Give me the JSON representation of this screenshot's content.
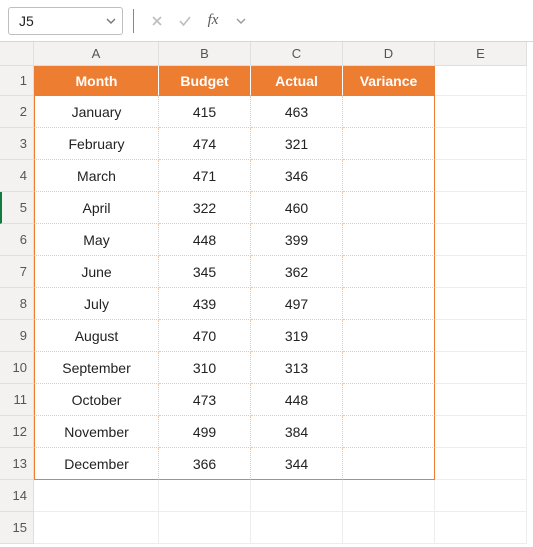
{
  "formula_bar": {
    "name_box_value": "J5",
    "formula_value": ""
  },
  "columns": [
    "A",
    "B",
    "C",
    "D",
    "E"
  ],
  "row_numbers": [
    "1",
    "2",
    "3",
    "4",
    "5",
    "6",
    "7",
    "8",
    "9",
    "10",
    "11",
    "12",
    "13",
    "14",
    "15"
  ],
  "active_row": "5",
  "table": {
    "headers": [
      "Month",
      "Budget",
      "Actual",
      "Variance"
    ],
    "rows": [
      {
        "month": "January",
        "budget": "415",
        "actual": "463",
        "variance": ""
      },
      {
        "month": "February",
        "budget": "474",
        "actual": "321",
        "variance": ""
      },
      {
        "month": "March",
        "budget": "471",
        "actual": "346",
        "variance": ""
      },
      {
        "month": "April",
        "budget": "322",
        "actual": "460",
        "variance": ""
      },
      {
        "month": "May",
        "budget": "448",
        "actual": "399",
        "variance": ""
      },
      {
        "month": "June",
        "budget": "345",
        "actual": "362",
        "variance": ""
      },
      {
        "month": "July",
        "budget": "439",
        "actual": "497",
        "variance": ""
      },
      {
        "month": "August",
        "budget": "470",
        "actual": "319",
        "variance": ""
      },
      {
        "month": "September",
        "budget": "310",
        "actual": "313",
        "variance": ""
      },
      {
        "month": "October",
        "budget": "473",
        "actual": "448",
        "variance": ""
      },
      {
        "month": "November",
        "budget": "499",
        "actual": "384",
        "variance": ""
      },
      {
        "month": "December",
        "budget": "366",
        "actual": "344",
        "variance": ""
      }
    ]
  }
}
